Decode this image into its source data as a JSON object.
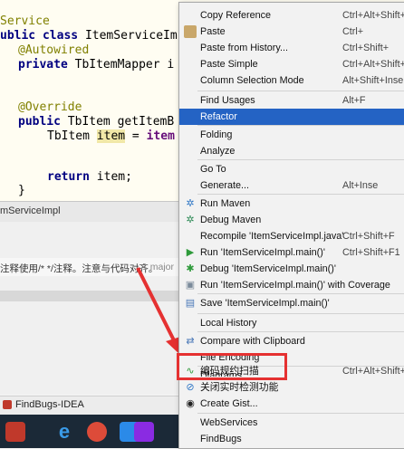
{
  "editor": {
    "lines": [
      {
        "kind": "service",
        "text": "Service"
      },
      {
        "kind": "class",
        "k1": "ublic ",
        "k2": "class ",
        "rest": "ItemServiceIm"
      },
      {
        "kind": "annotation",
        "text": "@Autowired"
      },
      {
        "kind": "field",
        "k1": "private ",
        "rest": "TbItemMapper i"
      },
      {
        "kind": "annotation",
        "text": "@Override"
      },
      {
        "kind": "method",
        "k1": "public ",
        "rest": "TbItem getItemB"
      },
      {
        "kind": "local",
        "pre": "TbItem ",
        "var": "item",
        "post": " = ",
        "tail": "item"
      },
      {
        "kind": "return",
        "k1": "return ",
        "rest": "item;"
      },
      {
        "kind": "brace",
        "text": "}"
      }
    ]
  },
  "tab_label": "mServiceImpl",
  "panel_text": "注释使用/* */注释。注意与代码对齐。",
  "panel_badge": "1 major",
  "status_text": "FindBugs-IDEA",
  "menu": {
    "items": [
      {
        "label": "Copy Reference",
        "shortcut": "Ctrl+Alt+Shift+",
        "icon": ""
      },
      {
        "label": "Paste",
        "shortcut": "Ctrl+",
        "icon": "paste-icon"
      },
      {
        "label": "Paste from History...",
        "shortcut": "Ctrl+Shift+",
        "icon": ""
      },
      {
        "label": "Paste Simple",
        "shortcut": "Ctrl+Alt+Shift+",
        "icon": ""
      },
      {
        "label": "Column Selection Mode",
        "shortcut": "Alt+Shift+Inse",
        "icon": ""
      },
      {
        "label": "Find Usages",
        "shortcut": "Alt+F",
        "icon": ""
      },
      {
        "label": "Refactor",
        "shortcut": "",
        "icon": ""
      },
      {
        "label": "Folding",
        "shortcut": "",
        "icon": ""
      },
      {
        "label": "Analyze",
        "shortcut": "",
        "icon": ""
      },
      {
        "label": "Go To",
        "shortcut": "",
        "icon": ""
      },
      {
        "label": "Generate...",
        "shortcut": "Alt+Inse",
        "icon": ""
      },
      {
        "label": "Run Maven",
        "shortcut": "",
        "icon": "maven-icon"
      },
      {
        "label": "Debug Maven",
        "shortcut": "",
        "icon": "maven-icon"
      },
      {
        "label": "Recompile 'ItemServiceImpl.java'",
        "shortcut": "Ctrl+Shift+F",
        "icon": ""
      },
      {
        "label": "Run 'ItemServiceImpl.main()'",
        "shortcut": "Ctrl+Shift+F1",
        "icon": "run-icon"
      },
      {
        "label": "Debug 'ItemServiceImpl.main()'",
        "shortcut": "",
        "icon": "debug-icon"
      },
      {
        "label": "Run 'ItemServiceImpl.main()' with Coverage",
        "shortcut": "",
        "icon": "coverage-icon"
      },
      {
        "label": "Save 'ItemServiceImpl.main()'",
        "shortcut": "",
        "icon": "save-icon"
      },
      {
        "label": "Local History",
        "shortcut": "",
        "icon": ""
      },
      {
        "label": "Compare with Clipboard",
        "shortcut": "",
        "icon": "compare-icon"
      },
      {
        "label": "File Encoding",
        "shortcut": "",
        "icon": ""
      },
      {
        "label": "Diagrams",
        "shortcut": "",
        "icon": ""
      },
      {
        "label": "编码规约扫描",
        "shortcut": "Ctrl+Alt+Shift+",
        "icon": "scan-icon"
      },
      {
        "label": "关闭实时检测功能",
        "shortcut": "",
        "icon": "close-detect-icon"
      },
      {
        "label": "Create Gist...",
        "shortcut": "",
        "icon": "github-icon"
      },
      {
        "label": "WebServices",
        "shortcut": "",
        "icon": ""
      },
      {
        "label": "FindBugs",
        "shortcut": "",
        "icon": ""
      }
    ]
  },
  "colors": {
    "selection": "#2463c4",
    "highlight_box": "#e53131",
    "keyword": "#000080",
    "annotation": "#808000"
  }
}
